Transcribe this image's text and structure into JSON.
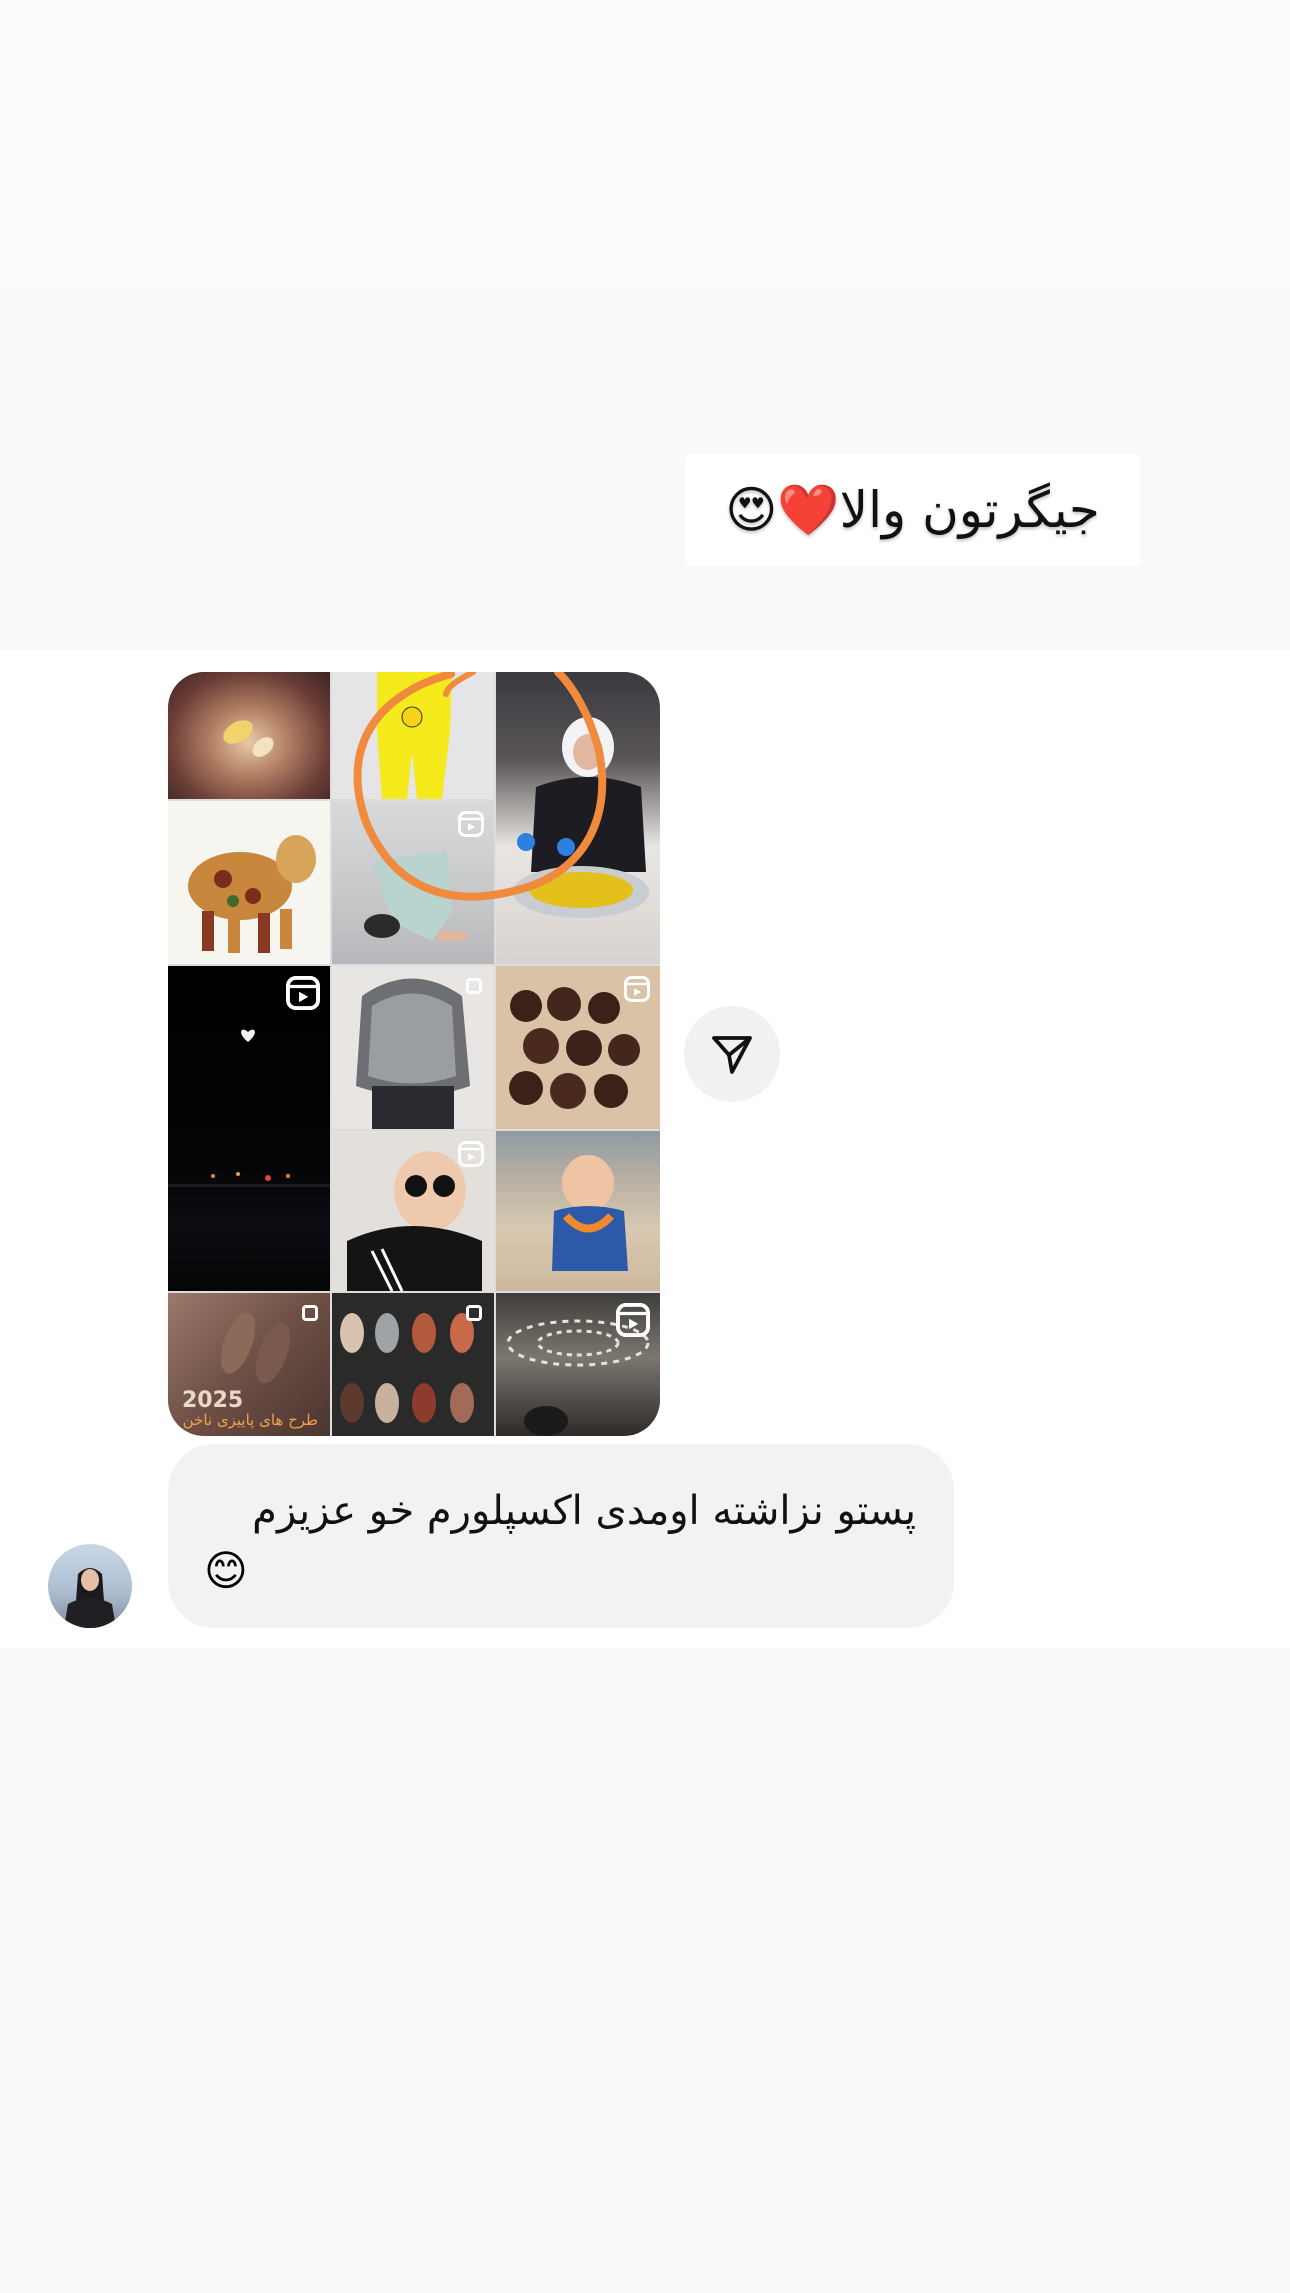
{
  "story": {
    "caption": "جیگرتون والا❤️😍"
  },
  "shared_post": {
    "tiles": [
      {
        "name": "nails-hand",
        "kind": "image"
      },
      {
        "name": "yellow-baby-outfit",
        "kind": "image"
      },
      {
        "name": "woman-cooking",
        "kind": "image"
      },
      {
        "name": "seed-cow-art",
        "kind": "image"
      },
      {
        "name": "baby-pants",
        "kind": "reel"
      },
      {
        "name": "night-road",
        "kind": "reel"
      },
      {
        "name": "bob-haircut",
        "kind": "carousel"
      },
      {
        "name": "chocolate-balls",
        "kind": "reel"
      },
      {
        "name": "baby-sunglasses",
        "kind": "reel"
      },
      {
        "name": "baby-beach",
        "kind": "image"
      },
      {
        "name": "autumn-nails",
        "kind": "carousel"
      },
      {
        "name": "nail-colors",
        "kind": "carousel"
      },
      {
        "name": "ceiling-lights",
        "kind": "reel"
      }
    ],
    "tile_texts": {
      "autumn_nails_year": "2025",
      "autumn_nails_caption": "طرح های پاییزی ناخن"
    },
    "annotation": {
      "color": "#f08a3c",
      "shape": "freehand-circle"
    }
  },
  "share_button": {
    "icon": "paper-plane-icon"
  },
  "message": {
    "text": "پستو نزاشته اومدی اکسپلورم خو عزیزم",
    "emoji": "😊"
  },
  "sender": {
    "avatar": "profile-photo"
  },
  "colors": {
    "bubble": "#f1f2f4",
    "chat_bg": "#ffffff",
    "page_bg": "#f9f9f9",
    "annotation": "#f08a3c"
  }
}
